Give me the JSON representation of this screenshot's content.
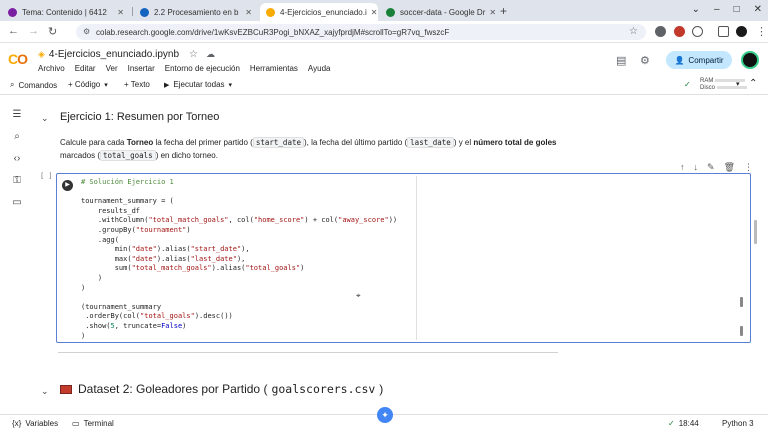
{
  "browser": {
    "tabs": [
      {
        "title": "Tema: Contenido | 6412",
        "color": "#7b1fa2"
      },
      {
        "title": "2.2 Procesamiento en b",
        "color": "#1565c0"
      },
      {
        "title": "4-Ejercicios_enunciado.i",
        "color": "#f9ab00"
      },
      {
        "title": "soccer-data - Google Dr",
        "color": "#188038"
      }
    ],
    "url": "colab.research.google.com/drive/1wKsvEZBCuR3Pogi_bNXAZ_xajyfprdjM#scrollTo=gR7vq_fwszcF"
  },
  "header": {
    "notebook_title": "4-Ejercicios_enunciado.ipynb",
    "menu": [
      "Archivo",
      "Editar",
      "Ver",
      "Insertar",
      "Entorno de ejecución",
      "Herramientas",
      "Ayuda"
    ],
    "share_label": "Compartir"
  },
  "toolbar": {
    "commands": "Comandos",
    "code": "+ Código",
    "text": "+ Texto",
    "run_all": "Ejecutar todas",
    "ram": "RAM",
    "disk": "Disco"
  },
  "section": {
    "title": "Ejercicio 1: Resumen por Torneo",
    "text_1": "Calcule para cada ",
    "text_torneo": "Torneo",
    "text_2": " la fecha del primer partido (",
    "code_start": "start_date",
    "text_3": "), la fecha del último partido (",
    "code_last": "last_date",
    "text_4": ") y el ",
    "text_num": "número total de goles",
    "text_5": " marcados (",
    "code_total": "total_goals",
    "text_6": ") en dicho torneo."
  },
  "cell": {
    "exec_count": "[ ]",
    "code_lines": [
      "# Solución Ejercicio 1",
      "",
      "tournament_summary = (",
      "    results_df",
      "    .withColumn(\"total_match_goals\", col(\"home_score\") + col(\"away_score\"))",
      "    .groupBy(\"tournament\")",
      "    .agg(",
      "        min(\"date\").alias(\"start_date\"),",
      "        max(\"date\").alias(\"last_date\"),",
      "        sum(\"total_match_goals\").alias(\"total_goals\")",
      "    )",
      ")",
      "",
      "(tournament_summary",
      " .orderBy(col(\"total_goals\").desc())",
      " .show(5, truncate=False)",
      ")"
    ]
  },
  "dataset": {
    "title_prefix": "Dataset 2: Goleadores por Partido (",
    "file": "goalscorers.csv",
    "title_suffix": ")"
  },
  "statusbar": {
    "variables": "Variables",
    "terminal": "Terminal",
    "time": "18:44",
    "kernel": "Python 3"
  }
}
